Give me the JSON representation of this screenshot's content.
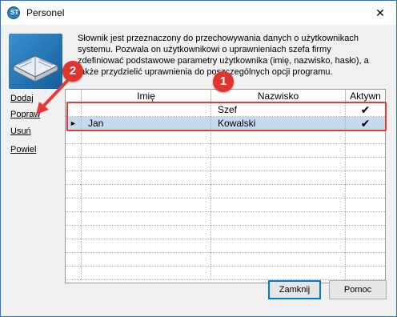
{
  "window": {
    "title": "Personel",
    "app_icon_text": "ST"
  },
  "description": "Słownik jest przeznaczony do przechowywania danych o użytkownikach systemu. Pozwala on użytkownikowi o uprawnieniach szefa firmy zdefiniować podstawowe parametry użytkownika (imię, nazwisko, hasło), a także przydzielić uprawnienia do poszczególnych opcji programu.",
  "sidebar": {
    "items": [
      {
        "label": "Dodaj"
      },
      {
        "label": "Popraw"
      },
      {
        "label": "Usuń"
      },
      {
        "label": "Powiel"
      }
    ]
  },
  "grid": {
    "columns": [
      "Imię",
      "Nazwisko",
      "Aktywn"
    ],
    "rows": [
      {
        "imie": "",
        "nazwisko": "Szef",
        "aktywny": true,
        "selected": false
      },
      {
        "imie": "Jan",
        "nazwisko": "Kowalski",
        "aktywny": true,
        "selected": true
      }
    ],
    "row_indicator": "►",
    "check_glyph": "✔"
  },
  "annotations": {
    "badge1": "1",
    "badge2": "2",
    "accent_color": "#e53935"
  },
  "buttons": {
    "close_label": "Zamknij",
    "help_label": "Pomoc"
  },
  "icons": {
    "close": "close-icon",
    "app": "app-icon",
    "book": "book-icon"
  }
}
